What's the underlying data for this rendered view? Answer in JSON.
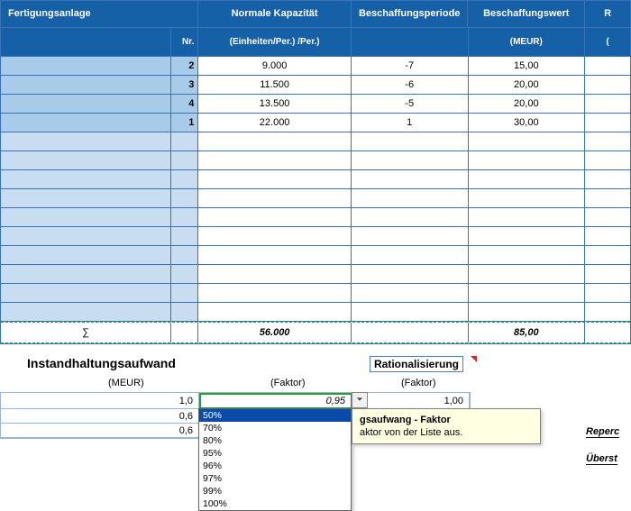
{
  "top": {
    "headers": {
      "col_a": "Fertigungsanlage",
      "col_nr": "Nr.",
      "col_b": "Normale Kapazität",
      "col_c": "Beschaffungsperiode",
      "col_d": "Beschaffungswert",
      "col_e": "R"
    },
    "subheaders": {
      "col_b": "(Einheiten/Per.) /Per.)",
      "col_d": "(MEUR)",
      "col_e": "("
    },
    "rows": [
      {
        "nr": "2",
        "kap": "9.000",
        "per": "-7",
        "wert": "15,00"
      },
      {
        "nr": "3",
        "kap": "11.500",
        "per": "-6",
        "wert": "20,00"
      },
      {
        "nr": "4",
        "kap": "13.500",
        "per": "-5",
        "wert": "20,00"
      },
      {
        "nr": "1",
        "kap": "22.000",
        "per": "1",
        "wert": "30,00"
      }
    ],
    "sum": {
      "label": "∑",
      "kap": "56.000",
      "wert": "85,00"
    }
  },
  "lower": {
    "title": "Instandhaltungsaufwand",
    "sub_meur": "(MEUR)",
    "sub_faktor": "(Faktor)",
    "rat_title": "Rationalisierung",
    "rat_sub": "(Faktor)",
    "rows": [
      {
        "meur": "1,0",
        "faktor": "0,95",
        "rat": "1,00"
      },
      {
        "meur": "0,6",
        "faktor": "",
        "rat": ""
      },
      {
        "meur": "0,6",
        "faktor": "",
        "rat": ""
      }
    ],
    "dropdown": {
      "selected_index": 0,
      "options": [
        "50%",
        "70%",
        "80%",
        "95%",
        "96%",
        "97%",
        "99%",
        "100%"
      ]
    },
    "tooltip": {
      "title_frag": "gsaufwang - Faktor",
      "body_frag": "aktor von der Liste aus."
    },
    "side1": "Reperc",
    "side2": "Überst"
  },
  "icons": {
    "chevron_down": "chevron-down-icon"
  }
}
